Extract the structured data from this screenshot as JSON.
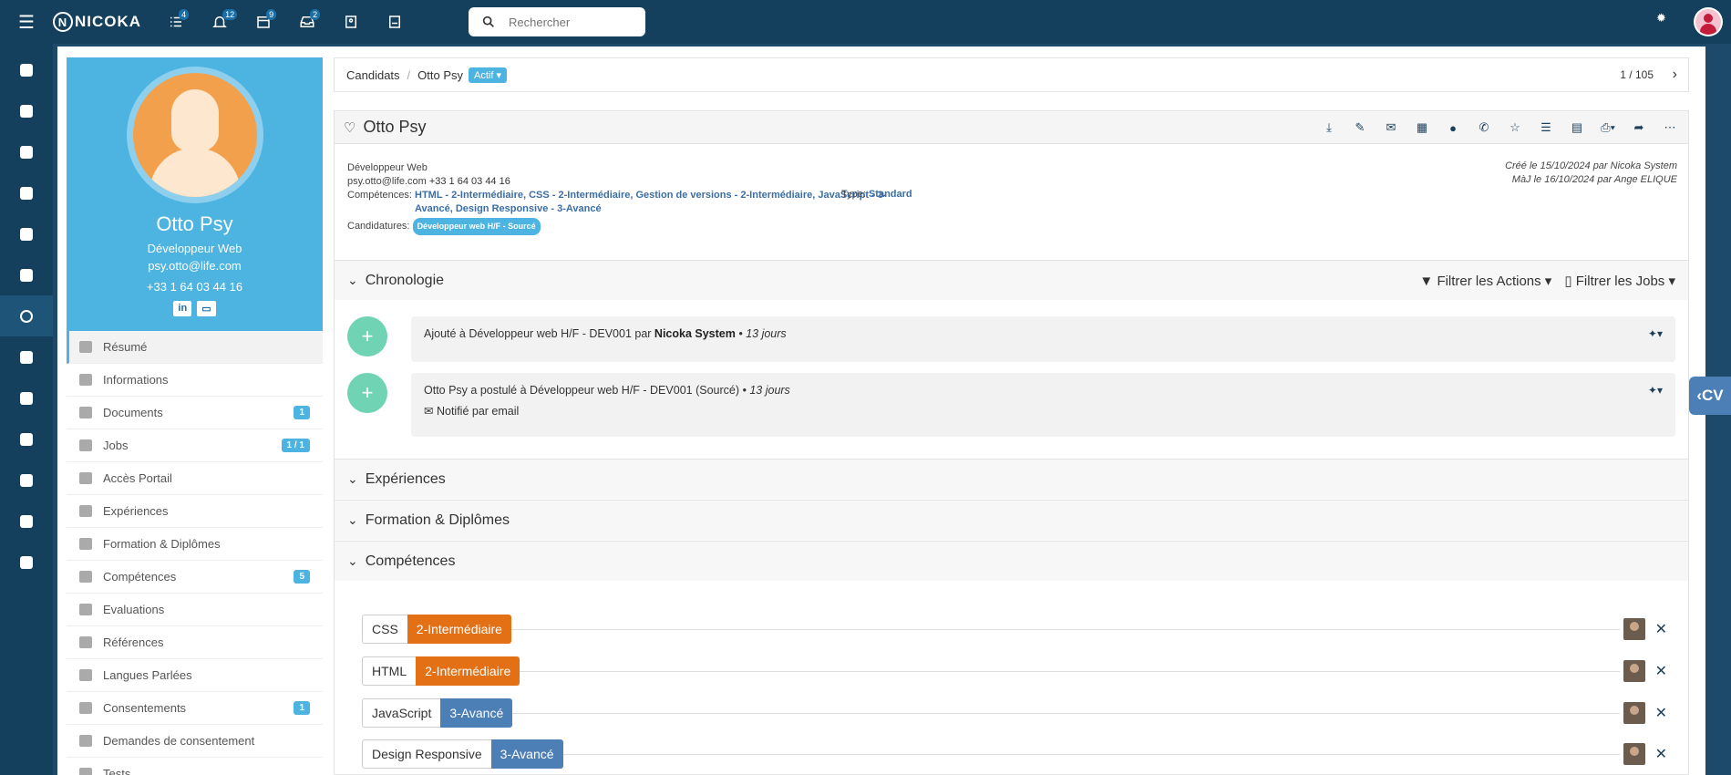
{
  "topbar": {
    "brand": "NICOKA",
    "icons": [
      {
        "name": "tasks-icon",
        "badge": "4"
      },
      {
        "name": "bell-icon",
        "badge": "12"
      },
      {
        "name": "calendar-icon",
        "badge": "9"
      },
      {
        "name": "inbox-icon",
        "badge": "2"
      },
      {
        "name": "contacts-icon",
        "badge": ""
      },
      {
        "name": "notes-icon",
        "badge": ""
      }
    ],
    "search_placeholder": "Rechercher"
  },
  "breadcrumb": {
    "root": "Candidats",
    "current": "Otto Psy",
    "status": "Actif",
    "pager": "1 / 105"
  },
  "profile": {
    "name": "Otto Psy",
    "job": "Développeur Web",
    "email": "psy.otto@life.com",
    "phone": "+33 1 64 03 44 16",
    "link_in": "in",
    "link_card": "▭"
  },
  "menu": [
    {
      "label": "Résumé",
      "badge": "",
      "icon": "user-icon"
    },
    {
      "label": "Informations",
      "badge": "",
      "icon": "id-card-icon"
    },
    {
      "label": "Documents",
      "badge": "1",
      "icon": "document-icon"
    },
    {
      "label": "Jobs",
      "badge": "1 / 1",
      "icon": "building-icon"
    },
    {
      "label": "Accès Portail",
      "badge": "",
      "icon": "key-icon"
    },
    {
      "label": "Expériences",
      "badge": "",
      "icon": "briefcase-icon"
    },
    {
      "label": "Formation & Diplômes",
      "badge": "",
      "icon": "graduation-icon"
    },
    {
      "label": "Compétences",
      "badge": "5",
      "icon": "star-icon"
    },
    {
      "label": "Evaluations",
      "badge": "",
      "icon": "star-half-icon"
    },
    {
      "label": "Références",
      "badge": "",
      "icon": "users-icon"
    },
    {
      "label": "Langues Parlées",
      "badge": "",
      "icon": "flag-icon"
    },
    {
      "label": "Consentements",
      "badge": "1",
      "icon": "lock-icon"
    },
    {
      "label": "Demandes de consentement",
      "badge": "",
      "icon": "lock-open-icon"
    },
    {
      "label": "Tests",
      "badge": "",
      "icon": "list-icon"
    }
  ],
  "card": {
    "title": "Otto Psy",
    "job": "Développeur Web",
    "email": "psy.otto@life.com",
    "phone": "+33 1 64 03 44 16",
    "competences_label": "Compétences:",
    "competences_value": "HTML - 2-Intermédiaire, CSS - 2-Intermédiaire, Gestion de versions - 2-Intermédiaire, JavaScript - 3-Avancé, Design Responsive - 3-Avancé",
    "candidatures_label": "Candidatures:",
    "candidature_chip": "Développeur web H/F - Sourcé",
    "type_label": "Type:",
    "type_value": "Standard",
    "created": "Créé le 15/10/2024 par Nicoka System",
    "updated": "MàJ le 16/10/2024 par Ange ELIQUE"
  },
  "sections": {
    "chronologie": "Chronologie",
    "filter_actions": "Filtrer les Actions",
    "filter_jobs": "Filtrer les Jobs",
    "experiences": "Expériences",
    "formation": "Formation & Diplômes",
    "competences": "Compétences"
  },
  "timeline": [
    {
      "text": "Ajouté à Développeur web H/F - DEV001 par ",
      "bold": "Nicoka System",
      "time": "• 13 jours",
      "sub": ""
    },
    {
      "text": "Otto Psy a postulé à Développeur web H/F - DEV001 (Sourcé) ",
      "bold": "",
      "time": "• 13 jours",
      "sub": "Notifié par email"
    }
  ],
  "skills": [
    {
      "name": "CSS",
      "level": "2-Intermédiaire",
      "color": "#e37014"
    },
    {
      "name": "HTML",
      "level": "2-Intermédiaire",
      "color": "#e37014"
    },
    {
      "name": "JavaScript",
      "level": "3-Avancé",
      "color": "#4d7fb7"
    },
    {
      "name": "Design Responsive",
      "level": "3-Avancé",
      "color": "#4d7fb7"
    }
  ],
  "cv_tab": "CV"
}
